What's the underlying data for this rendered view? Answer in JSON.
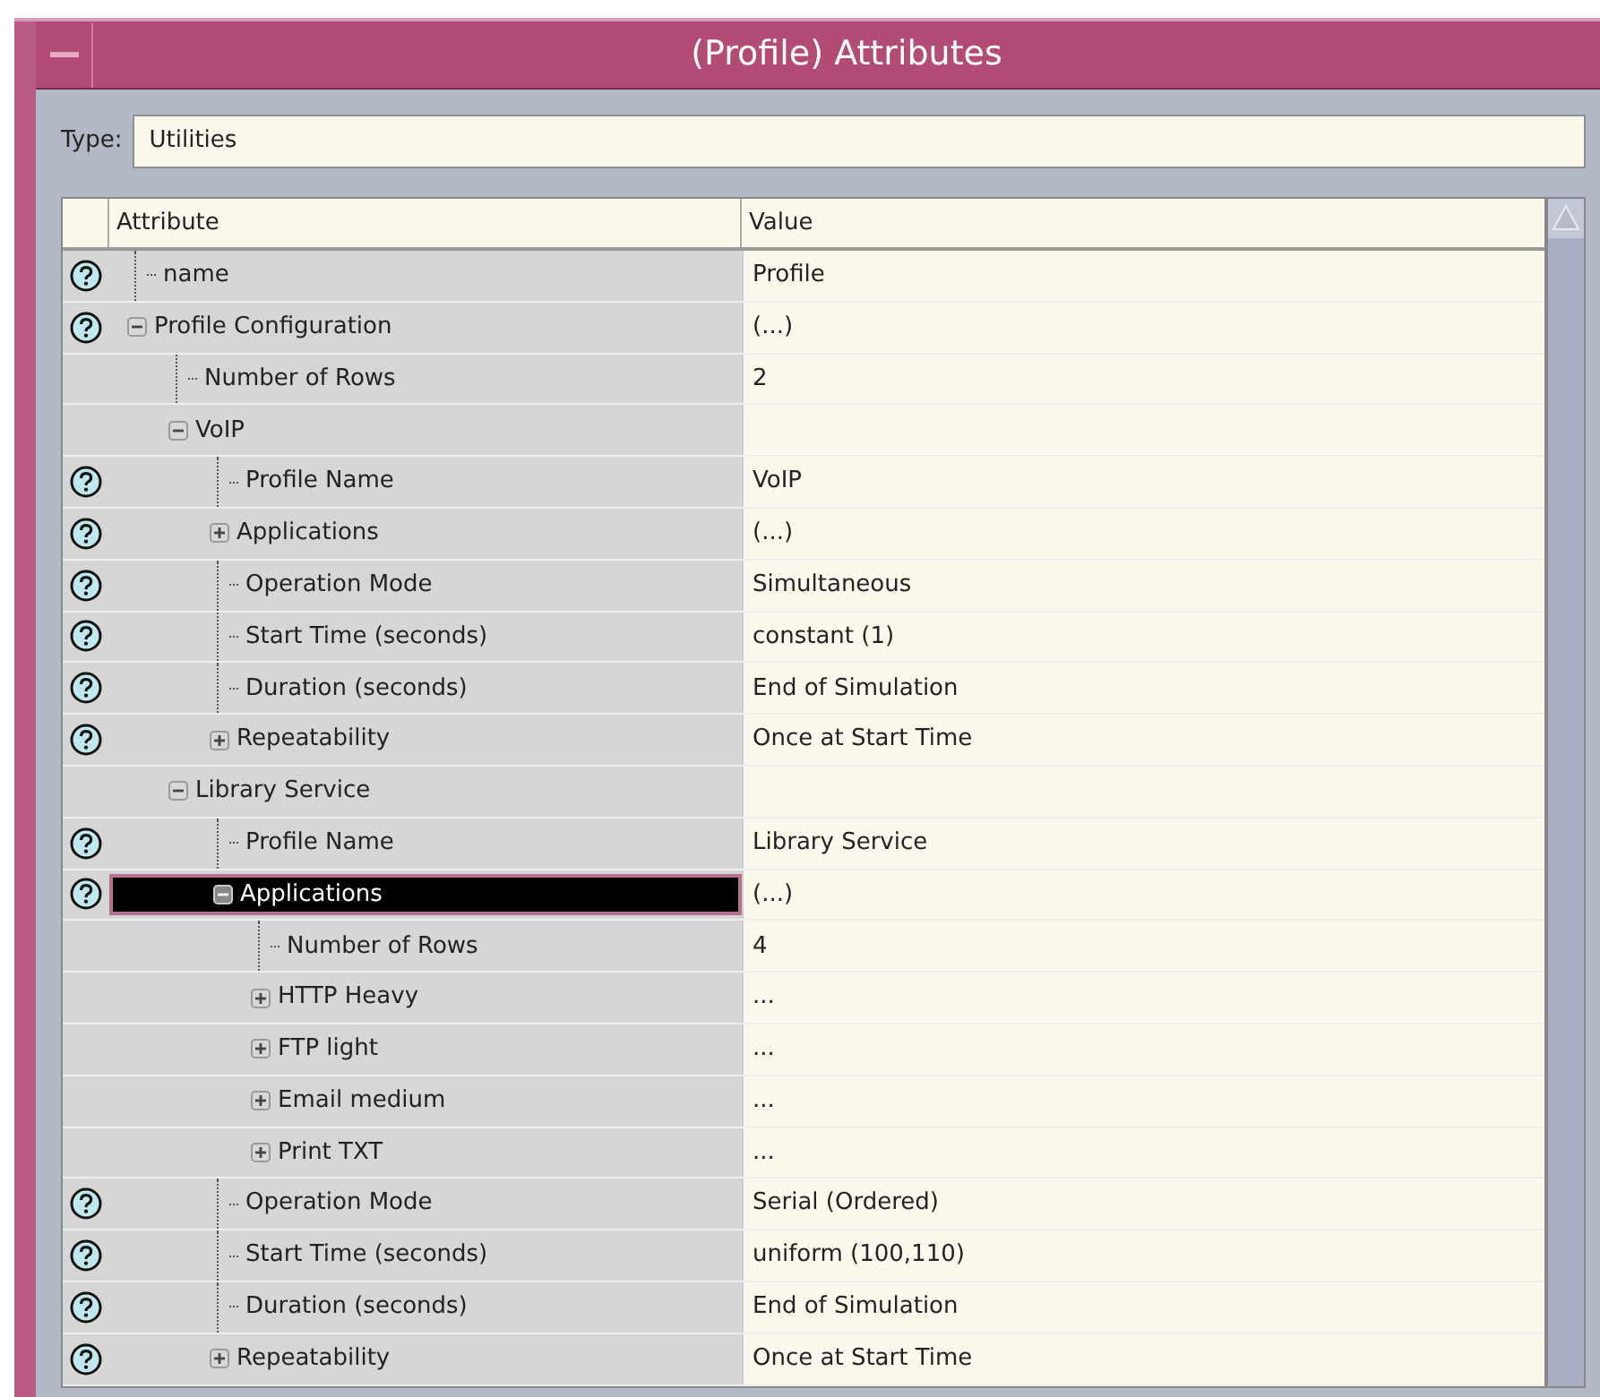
{
  "window": {
    "title": "(Profile) Attributes"
  },
  "type_field": {
    "label": "Type:",
    "value": "Utilities"
  },
  "table": {
    "columns": [
      "Attribute",
      "Value"
    ],
    "rows": [
      {
        "label": "name",
        "value": "Profile",
        "help": true,
        "selected": false
      },
      {
        "label": "Profile Configuration",
        "value": "(...)",
        "help": true,
        "selected": false,
        "expanded": true,
        "children": [
          {
            "label": "Number of Rows",
            "value": "2",
            "help": false,
            "selected": false
          },
          {
            "label": "VoIP",
            "help": false,
            "selected": false,
            "expanded": true,
            "children": [
              {
                "label": "Profile Name",
                "value": "VoIP",
                "help": true,
                "selected": false
              },
              {
                "label": "Applications",
                "value": "(...)",
                "help": true,
                "selected": false,
                "expanded": false
              },
              {
                "label": "Operation Mode",
                "value": "Simultaneous",
                "help": true,
                "selected": false
              },
              {
                "label": "Start Time (seconds)",
                "value": "constant (1)",
                "help": true,
                "selected": false
              },
              {
                "label": "Duration (seconds)",
                "value": "End of Simulation",
                "help": true,
                "selected": false
              },
              {
                "label": "Repeatability",
                "value": "Once at Start Time",
                "help": true,
                "selected": false,
                "expanded": false
              }
            ]
          },
          {
            "label": "Library Service",
            "help": false,
            "selected": false,
            "expanded": true,
            "children": [
              {
                "label": "Profile Name",
                "value": "Library Service",
                "help": true,
                "selected": false
              },
              {
                "label": "Applications",
                "value": "(...)",
                "help": true,
                "selected": true,
                "expanded": true,
                "children": [
                  {
                    "label": "Number of Rows",
                    "value": "4",
                    "help": false,
                    "selected": false
                  },
                  {
                    "label": "HTTP Heavy",
                    "value": "...",
                    "help": false,
                    "selected": false,
                    "expanded": false
                  },
                  {
                    "label": "FTP light",
                    "value": "...",
                    "help": false,
                    "selected": false,
                    "expanded": false
                  },
                  {
                    "label": "Email medium",
                    "value": "...",
                    "help": false,
                    "selected": false,
                    "expanded": false
                  },
                  {
                    "label": "Print TXT",
                    "value": "...",
                    "help": false,
                    "selected": false,
                    "expanded": false
                  }
                ]
              },
              {
                "label": "Operation Mode",
                "value": "Serial (Ordered)",
                "help": true,
                "selected": false
              },
              {
                "label": "Start Time (seconds)",
                "value": "uniform (100,110)",
                "help": true,
                "selected": false
              },
              {
                "label": "Duration (seconds)",
                "value": "End of Simulation",
                "help": true,
                "selected": false
              },
              {
                "label": "Repeatability",
                "value": "Once at Start Time",
                "help": true,
                "selected": false,
                "expanded": false
              }
            ]
          }
        ]
      }
    ]
  }
}
